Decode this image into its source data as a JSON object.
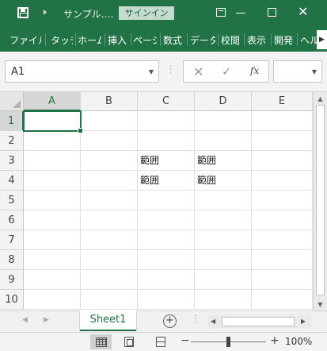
{
  "titlebar": {
    "filename": "サンプル.…",
    "signin_label": "サインイン",
    "close_glyph": "✕",
    "more_glyph": "››",
    "colors": {
      "brand": "#217346"
    }
  },
  "ribbon": {
    "tabs": [
      {
        "label": "ファイル"
      },
      {
        "label": "タッチ"
      },
      {
        "label": "ホーム"
      },
      {
        "label": "挿入"
      },
      {
        "label": "ページ"
      },
      {
        "label": "数式"
      },
      {
        "label": "データ"
      },
      {
        "label": "校閲"
      },
      {
        "label": "表示"
      },
      {
        "label": "開発"
      },
      {
        "label": "ヘルプ"
      }
    ],
    "scroll_glyph": "▶"
  },
  "formula_bar": {
    "name_box": "A1",
    "cancel_glyph": "✕",
    "enter_glyph": "✓",
    "fx_label": "fx",
    "formula": ""
  },
  "grid": {
    "columns": [
      "A",
      "B",
      "C",
      "D",
      "E"
    ],
    "rows": [
      "1",
      "2",
      "3",
      "4",
      "5",
      "6",
      "7",
      "8",
      "9",
      "10"
    ],
    "cells": {
      "C3": "範囲",
      "D3": "範囲",
      "C4": "範囲",
      "D4": "範囲"
    },
    "active_cell": "A1"
  },
  "sheets": {
    "tabs": [
      {
        "label": "Sheet1"
      }
    ],
    "add_glyph": "+"
  },
  "statusbar": {
    "zoom_minus": "−",
    "zoom_plus": "+",
    "zoom_level": "100%"
  }
}
